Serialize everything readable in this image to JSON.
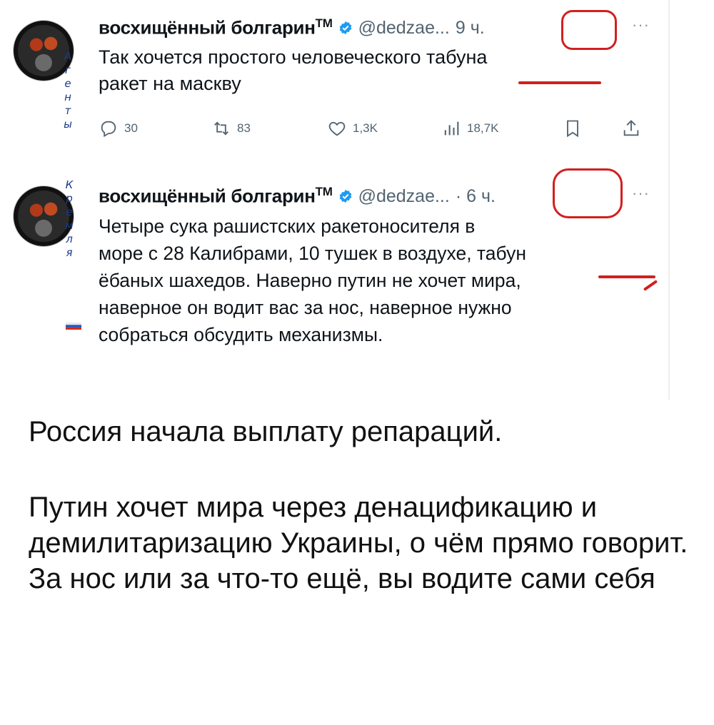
{
  "post1": {
    "name": "восхищённый болгарин",
    "tm": "TM",
    "handle": "@dedzae...",
    "time": "9 ч.",
    "more": "···",
    "text_line1": "Так хочется простого человеческого табуна",
    "text_line2": "ракет на маскву",
    "stats": {
      "replies": "30",
      "reposts": "83",
      "likes": "1,3K",
      "views": "18,7K"
    }
  },
  "post2": {
    "name": "восхищённый болгарин",
    "tm": "TM",
    "handle": "@dedzae...",
    "time": "· 6 ч.",
    "more": "···",
    "lines": [
      "Четыре сука рашистских ракетоносителя в",
      "море с 28 Калибрами, 10 тушек в воздухе, табун",
      "ёбаных шахедов. Наверно путин не хочет мира,",
      "наверное он водит вас за нос, наверное нужно",
      "собраться обсудить механизмы."
    ]
  },
  "side_letters_1": [
    "А",
    "г",
    "е",
    "н",
    "т",
    "ы"
  ],
  "side_letters_2": [
    "К",
    "р",
    "е",
    "м",
    "л",
    "я"
  ],
  "caption": {
    "line1": "Россия начала выплату репараций.",
    "para2": "Путин хочет мира через денацификацию и демилитаризацию Украины, о чём прямо говорит. За нос или за что-то ещё, вы водите сами себя"
  },
  "colors": {
    "accent_red": "#d21f1f",
    "verified_blue": "#1d9bf0",
    "muted_text": "#536471",
    "side_letters": "#1a3a8a"
  },
  "icons": [
    "reply-icon",
    "repost-icon",
    "like-icon",
    "views-icon",
    "bookmark-icon",
    "share-icon",
    "verified-icon"
  ]
}
